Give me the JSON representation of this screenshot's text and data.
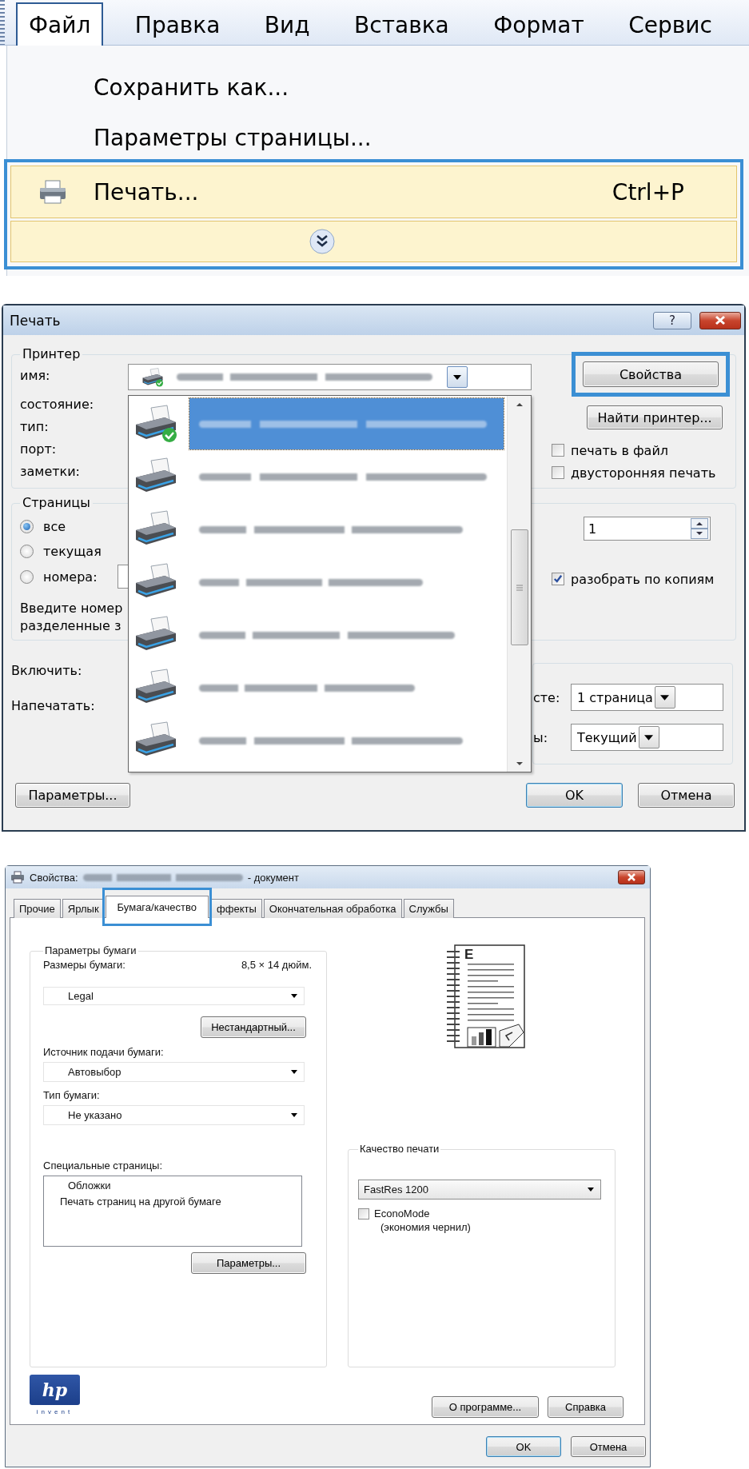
{
  "app_menu": {
    "menu_bar": [
      {
        "label": "Файл",
        "selected": true
      },
      {
        "label": "Правка",
        "selected": false
      },
      {
        "label": "Вид",
        "selected": false
      },
      {
        "label": "Вставка",
        "selected": false
      },
      {
        "label": "Формат",
        "selected": false
      },
      {
        "label": "Сервис",
        "selected": false
      }
    ],
    "items": [
      {
        "kind": "command",
        "label": "Сохранить как...",
        "highlighted": false,
        "callout": false
      },
      {
        "kind": "command",
        "label": "Параметры страницы...",
        "highlighted": false,
        "callout": false
      },
      {
        "kind": "print",
        "label": "Печать...",
        "shortcut": "Ctrl+P",
        "highlighted": true,
        "callout": true
      },
      {
        "kind": "expand",
        "highlighted": true,
        "callout": true
      }
    ]
  },
  "print_dialog": {
    "title": "Печать",
    "help_button": "?",
    "printer_group": {
      "legend": "Принтер",
      "labels": [
        "имя:",
        "состояние:",
        "тип:",
        "порт:",
        "заметки:"
      ],
      "properties_button": {
        "label": "Свойства",
        "callout": true
      },
      "find_button": "Найти принтер...",
      "options": [
        {
          "label": "печать в файл",
          "checked": false
        },
        {
          "label": "двусторонняя печать",
          "checked": false
        }
      ]
    },
    "printer_list": [
      {
        "selected": true,
        "default": true
      },
      {
        "selected": false,
        "default": false
      },
      {
        "selected": false,
        "default": false
      },
      {
        "selected": false,
        "default": false
      },
      {
        "selected": false,
        "default": false
      },
      {
        "selected": false,
        "default": false
      },
      {
        "selected": false,
        "default": false
      }
    ],
    "pages_group": {
      "legend": "Страницы",
      "ranges": [
        {
          "label": "все",
          "selected": true
        },
        {
          "label": "текущая",
          "selected": false
        },
        {
          "label": "номера:",
          "selected": false
        }
      ],
      "hint_lines": [
        "Введите номер",
        "разделенные з"
      ],
      "copies": "1",
      "collate": {
        "label": "разобрать по копиям",
        "checked": true
      }
    },
    "include_label": "Включить:",
    "print_label": "Напечатать:",
    "scale_fields": [
      {
        "label": "сте:",
        "value": "1 страница"
      },
      {
        "label": "ы:",
        "value": "Текущий"
      }
    ],
    "buttons": [
      {
        "label": "Параметры...",
        "default": false
      },
      {
        "label": "OK",
        "default": true
      },
      {
        "label": "Отмена",
        "default": false
      }
    ]
  },
  "properties_dialog": {
    "title_prefix": "Свойства:",
    "title_suffix": "- документ",
    "tabs": [
      {
        "label": "Прочие",
        "selected": false,
        "callout": false
      },
      {
        "label": "Ярлык",
        "selected": false,
        "callout": false
      },
      {
        "label": "Бумага/качество",
        "selected": true,
        "callout": true
      },
      {
        "label": "ффекты",
        "selected": false,
        "callout": false
      },
      {
        "label": "Окончательная обработка",
        "selected": false,
        "callout": false
      },
      {
        "label": "Службы",
        "selected": false,
        "callout": false
      }
    ],
    "paper_group": {
      "legend": "Параметры бумаги",
      "size_label": "Размеры бумаги:",
      "size_value": "8,5 × 14 дюйм.",
      "size_select": "Legal",
      "custom_button": "Нестандартный...",
      "source_label": "Источник подачи бумаги:",
      "source_select": "Автовыбор",
      "type_label": "Тип бумаги:",
      "type_select": "Не указано",
      "special_label": "Специальные страницы:",
      "special_list": [
        "Обложки",
        "Печать страниц на другой бумаге"
      ],
      "special_button": "Параметры..."
    },
    "preview_letter": "E",
    "quality_group": {
      "legend": "Качество печати",
      "select": "FastRes 1200",
      "econo": {
        "label": "EconoMode",
        "note": "(экономия чернил)",
        "checked": false
      }
    },
    "logo": {
      "mark": "hp",
      "tagline": "invent"
    },
    "side_buttons": [
      "О программе...",
      "Справка"
    ],
    "buttons": [
      {
        "label": "OK",
        "default": true
      },
      {
        "label": "Отмена",
        "default": false
      }
    ]
  }
}
